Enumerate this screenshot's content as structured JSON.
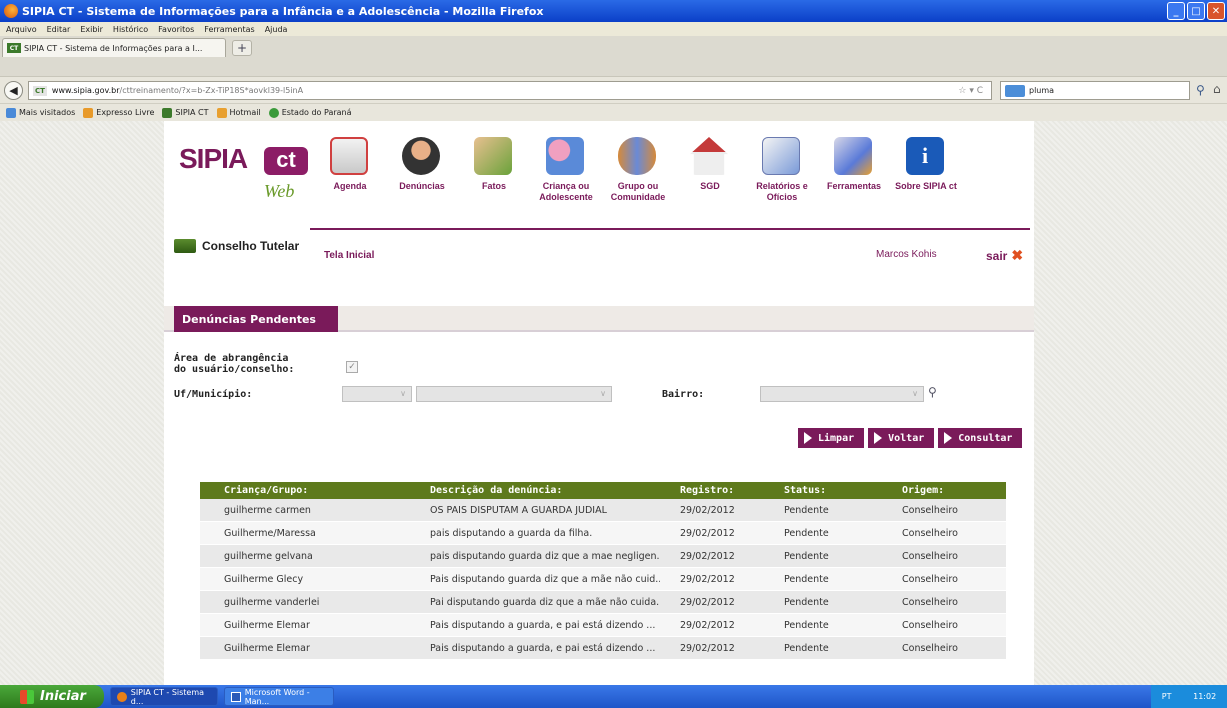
{
  "window": {
    "title": "SIPIA CT - Sistema de Informações para a Infância e a Adolescência - Mozilla Firefox"
  },
  "menubar": [
    "Arquivo",
    "Editar",
    "Exibir",
    "Histórico",
    "Favoritos",
    "Ferramentas",
    "Ajuda"
  ],
  "tab": {
    "label": "SIPIA CT - Sistema de Informações para a I...",
    "new_tab": "+"
  },
  "nav": {
    "url_host": "www.sipia.gov.br",
    "url_path": "/cttreinamento/?x=b-Zx-TiP18S*aovkl39-l5inA",
    "search_value": "pluma"
  },
  "bookmarks": [
    "Mais visitados",
    "Expresso Livre",
    "SIPIA CT",
    "Hotmail",
    "Estado do Paraná"
  ],
  "site": {
    "logo_sipia": "SIPIA",
    "logo_ct": "ct",
    "logo_web": "Web",
    "conselho": "Conselho Tutelar",
    "menu": [
      {
        "label": "Agenda",
        "icon": "calendar-icon"
      },
      {
        "label": "Denúncias",
        "icon": "person-icon"
      },
      {
        "label": "Fatos",
        "icon": "facts-icon"
      },
      {
        "label": "Criança ou Adolescente",
        "icon": "child-icon"
      },
      {
        "label": "Grupo ou Comunidade",
        "icon": "group-icon"
      },
      {
        "label": "SGD",
        "icon": "house-icon"
      },
      {
        "label": "Relatórios e Ofícios",
        "icon": "documents-icon"
      },
      {
        "label": "Ferramentas",
        "icon": "tools-icon"
      },
      {
        "label": "Sobre SIPIA ct",
        "icon": "info-icon"
      }
    ],
    "breadcrumb": "Tela Inicial",
    "user": "Marcos Kohis",
    "logout": "sair"
  },
  "panel": {
    "tab_title": "Denúncias Pendentes",
    "area_label_1": "Área de abrangência",
    "area_label_2": "do usuário/conselho:",
    "uf_label": "Uf/Município:",
    "bairro_label": "Bairro:",
    "buttons": {
      "limpar": "Limpar",
      "voltar": "Voltar",
      "consultar": "Consultar"
    }
  },
  "table": {
    "headers": [
      "Criança/Grupo:",
      "Descrição da denúncia:",
      "Registro:",
      "Status:",
      "Origem:"
    ],
    "rows": [
      [
        "guilherme carmen",
        "OS PAIS DISPUTAM A GUARDA JUDIAL",
        "29/02/2012",
        "Pendente",
        "Conselheiro"
      ],
      [
        "Guilherme/Maressa",
        "pais disputando a guarda da filha.",
        "29/02/2012",
        "Pendente",
        "Conselheiro"
      ],
      [
        "guilherme gelvana",
        "pais disputando guarda diz que a mae negligen...",
        "29/02/2012",
        "Pendente",
        "Conselheiro"
      ],
      [
        "Guilherme Glecy",
        "Pais disputando guarda diz que a mãe não cuid...",
        "29/02/2012",
        "Pendente",
        "Conselheiro"
      ],
      [
        "guilherme vanderlei",
        "Pai disputando guarda diz que a mãe não cuida...",
        "29/02/2012",
        "Pendente",
        "Conselheiro"
      ],
      [
        "Guilherme Elemar",
        "Pais disputando a guarda, e pai está dizendo ...",
        "29/02/2012",
        "Pendente",
        "Conselheiro"
      ],
      [
        "Guilherme Elemar",
        "Pais disputando a guarda, e pai está dizendo ...",
        "29/02/2012",
        "Pendente",
        "Conselheiro"
      ]
    ]
  },
  "taskbar": {
    "start": "Iniciar",
    "tasks": [
      "SIPIA CT - Sistema d...",
      "Microsoft Word - Man..."
    ],
    "tray_lang": "PT",
    "tray_time": "11:02"
  },
  "colors": {
    "brand": "#7a1a5a",
    "table_header": "#5e7a1c",
    "web_green": "#6a9a2a"
  }
}
